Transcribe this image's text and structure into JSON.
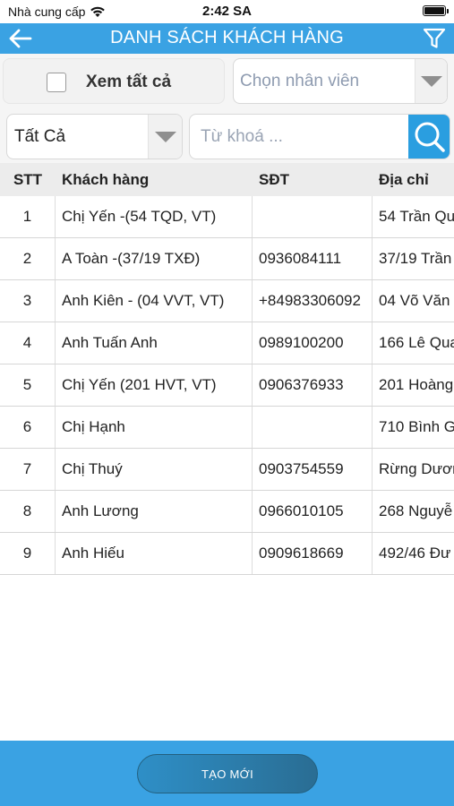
{
  "status_bar": {
    "carrier": "Nhà cung cấp",
    "time": "2:42 SA"
  },
  "nav": {
    "title": "DANH SÁCH KHÁCH HÀNG"
  },
  "filters": {
    "view_all_label": "Xem tất cả",
    "staff_placeholder": "Chọn nhân viên",
    "type_value": "Tất Cả",
    "search_placeholder": "Từ khoá ..."
  },
  "table": {
    "headers": {
      "stt": "STT",
      "name": "Khách hàng",
      "phone": "SĐT",
      "address": "Địa chỉ"
    },
    "rows": [
      {
        "stt": "1",
        "name": "Chị Yến -(54 TQD, VT)",
        "phone": "",
        "address": "54 Trần Qu"
      },
      {
        "stt": "2",
        "name": "A Toàn -(37/19 TXĐ)",
        "phone": "0936084111",
        "address": "37/19 Trần"
      },
      {
        "stt": "3",
        "name": "Anh Kiên - (04 VVT, VT)",
        "phone": "+84983306092",
        "address": "04 Võ Văn"
      },
      {
        "stt": "4",
        "name": "Anh Tuấn Anh",
        "phone": "0989100200",
        "address": "166 Lê Qua"
      },
      {
        "stt": "5",
        "name": "Chị Yến (201 HVT, VT)",
        "phone": "0906376933",
        "address": "201 Hoàng"
      },
      {
        "stt": "6",
        "name": "Chị Hạnh",
        "phone": "",
        "address": "710 Bình G"
      },
      {
        "stt": "7",
        "name": "Chị Thuý",
        "phone": "0903754559",
        "address": "Rừng Dươn"
      },
      {
        "stt": "8",
        "name": "Anh Lương",
        "phone": "0966010105",
        "address": "268 Nguyễ"
      },
      {
        "stt": "9",
        "name": "Anh Hiếu",
        "phone": "0909618669",
        "address": "492/46 Đư"
      }
    ]
  },
  "footer": {
    "create_label": "TẠO MỚI"
  },
  "colors": {
    "primary": "#3aa2e3",
    "search_button": "#2a9ee0"
  },
  "icons": [
    "wifi-icon",
    "battery-icon",
    "back-arrow-icon",
    "filter-icon",
    "checkbox-icon",
    "dropdown-arrow-icon",
    "search-icon"
  ]
}
